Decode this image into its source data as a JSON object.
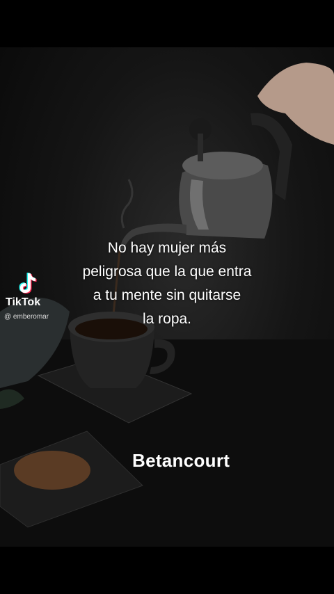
{
  "quote": {
    "lines": [
      "No hay mujer más",
      "peligrosa que la que entra",
      "a tu mente sin quitarse",
      "la ropa."
    ]
  },
  "author": "Betancourt",
  "watermark": {
    "brand": "TikTok",
    "handle": "@ emberomar"
  },
  "colors": {
    "background": "#000000",
    "text": "#ffffff",
    "tiktok_cyan": "#25f4ee",
    "tiktok_red": "#fe2c55"
  }
}
